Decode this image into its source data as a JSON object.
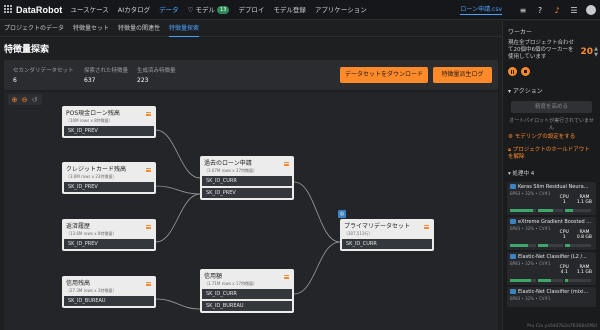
{
  "app": {
    "logo_text": "DataRobot"
  },
  "nav": [
    {
      "label": "ユースケース",
      "active": false
    },
    {
      "label": "AIカタログ",
      "active": false
    },
    {
      "label": "データ",
      "active": true
    },
    {
      "label": "モデル",
      "badge": "13",
      "active": false
    },
    {
      "label": "デプロイ",
      "active": false
    },
    {
      "label": "モデル登録",
      "active": false
    },
    {
      "label": "アプリケーション",
      "active": false
    }
  ],
  "topright": {
    "dataset": "ローン申請.csv"
  },
  "subnav": [
    {
      "label": "プロジェクトのデータ",
      "active": false
    },
    {
      "label": "特徴量セット",
      "active": false
    },
    {
      "label": "特徴量の関連性",
      "active": false
    },
    {
      "label": "特徴量探索",
      "active": true
    }
  ],
  "page_title": "特徴量探索",
  "stats": [
    {
      "label": "セカンダリデータセット",
      "value": "6"
    },
    {
      "label": "探索された特徴量",
      "value": "637"
    },
    {
      "label": "生成済み特徴量",
      "value": "223"
    }
  ],
  "buttons": {
    "download": "データセットをダウンロード",
    "log": "特徴量派生ログ"
  },
  "nodes": [
    {
      "id": "pos",
      "title": "POS現金ローン残高",
      "sub": "（10M rows x 8特徴量）",
      "keys": [
        "SK_ID_PREV"
      ]
    },
    {
      "id": "credit",
      "title": "クレジットカード残高",
      "sub": "（3.8M rows x 23特徴量）",
      "keys": [
        "SK_ID_PREV"
      ]
    },
    {
      "id": "install",
      "title": "返済履歴",
      "sub": "（13.6M rows x 8特徴量）",
      "keys": [
        "SK_ID_PREV"
      ]
    },
    {
      "id": "bureau_bal",
      "title": "信用残高",
      "sub": "（27.3M rows x 3特徴量）",
      "keys": [
        "SK_ID_BUREAU"
      ]
    },
    {
      "id": "prev",
      "title": "過去のローン申請",
      "sub": "（1.67M rows x 37特徴量）",
      "keys": [
        "SK_ID_CURR",
        "SK_ID_PREV"
      ]
    },
    {
      "id": "bureau",
      "title": "信用額",
      "sub": "（1.71M rows x 17特徴量）",
      "keys": [
        "SK_ID_CURR",
        "SK_ID_BUREAU"
      ]
    },
    {
      "id": "primary",
      "title": "プライマリデータセット",
      "sub": "（307,511行）",
      "keys": [
        "SK_ID_CURR"
      ],
      "pin": "◎"
    }
  ],
  "panel": {
    "worker_header": "ワーカー",
    "worker_text": "現在全プロジェクト合わせて20個中6個のワーカーを使用しています",
    "worker_count": "20",
    "action_header": "アクション",
    "action_button": "精度を高める",
    "action_hint": "オートパイロットが実行されていません",
    "link_modeling": "モデリングの設定をする",
    "link_holdout": "プロジェクトのホールドアウトを解除",
    "queue_header": "処理中",
    "queue_count": "4",
    "jobs": [
      {
        "title": "Keras Slim Residual Neura...",
        "sub": "BP93 • 32% • CV#1",
        "cpu_label": "CPU",
        "cpu": "1",
        "ram_label": "RAM",
        "ram": "1.1 GB",
        "progress": [
          0.9,
          0.6,
          0.3
        ]
      },
      {
        "title": "eXtreme Gradient Boosted ...",
        "sub": "BP83 • 32% • CV#1",
        "cpu_label": "CPU",
        "cpu": "1",
        "ram_label": "RAM",
        "ram": "0.8 GB",
        "progress": [
          0.7,
          0.4,
          0.2
        ]
      },
      {
        "title": "Elastic-Net Classifier (L2 /...",
        "sub": "BP83 • 32% • CV#1",
        "cpu_label": "CPU",
        "cpu": "4.1",
        "ram_label": "RAM",
        "ram": "1.1 GB",
        "progress": [
          0.8,
          0.5,
          0.1
        ]
      },
      {
        "title": "Elastic-Net Classifier (mixi...",
        "sub": "BP83 • 32% • CV#1"
      }
    ],
    "footer_code": "Pro Cla ya5dd7b2e76368a5f6d"
  }
}
